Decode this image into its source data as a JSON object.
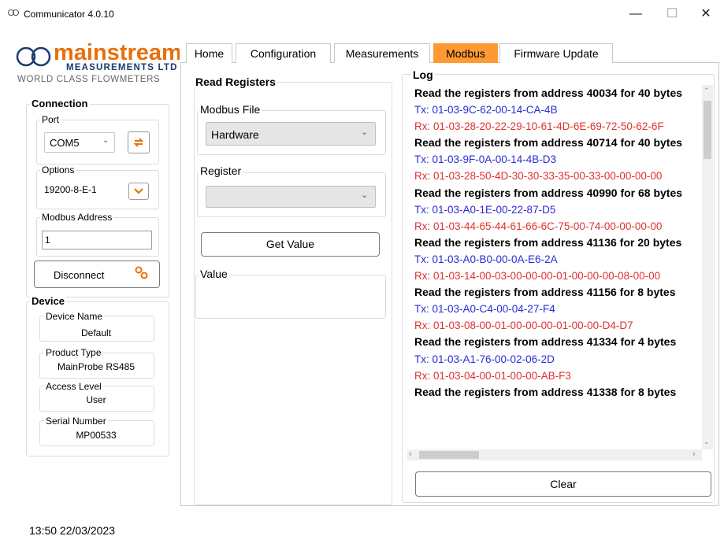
{
  "window": {
    "title": "Communicator 4.0.10",
    "controls": [
      "—",
      "☐",
      "✕"
    ]
  },
  "logo": {
    "brand": "mainstream",
    "sub": "MEASUREMENTS LTD",
    "tagline": "WORLD CLASS FLOWMETERS"
  },
  "connection": {
    "title": "Connection",
    "port_label": "Port",
    "port_value": "COM5",
    "options_label": "Options",
    "options_value": "19200-8-E-1",
    "address_label": "Modbus Address",
    "address_value": "1",
    "disconnect_label": "Disconnect"
  },
  "device": {
    "title": "Device",
    "name_label": "Device Name",
    "name_value": "Default",
    "product_label": "Product Type",
    "product_value": "MainProbe RS485",
    "access_label": "Access Level",
    "access_value": "User",
    "serial_label": "Serial Number",
    "serial_value": "MP00533"
  },
  "tabs": [
    {
      "label": "Home",
      "active": false
    },
    {
      "label": "Configuration",
      "active": false
    },
    {
      "label": "Measurements",
      "active": false
    },
    {
      "label": "Modbus",
      "active": true
    },
    {
      "label": "Firmware Update",
      "active": false
    }
  ],
  "read_registers": {
    "title": "Read Registers",
    "file_label": "Modbus File",
    "file_value": "Hardware",
    "register_label": "Register",
    "register_value": "",
    "get_value_label": "Get Value",
    "value_label": "Value"
  },
  "log": {
    "title": "Log",
    "clear_label": "Clear",
    "entries": [
      {
        "kind": "read",
        "text": "Read the registers from address 40034 for 40 bytes"
      },
      {
        "kind": "tx",
        "text": "Tx: 01-03-9C-62-00-14-CA-4B"
      },
      {
        "kind": "rx",
        "text": "Rx: 01-03-28-20-22-29-10-61-4D-6E-69-72-50-62-6F"
      },
      {
        "kind": "read",
        "text": "Read the registers from address 40714 for 40 bytes"
      },
      {
        "kind": "tx",
        "text": "Tx: 01-03-9F-0A-00-14-4B-D3"
      },
      {
        "kind": "rx",
        "text": "Rx: 01-03-28-50-4D-30-30-33-35-00-33-00-00-00-00"
      },
      {
        "kind": "read",
        "text": "Read the registers from address 40990 for 68 bytes"
      },
      {
        "kind": "tx",
        "text": "Tx: 01-03-A0-1E-00-22-87-D5"
      },
      {
        "kind": "rx",
        "text": "Rx: 01-03-44-65-44-61-66-6C-75-00-74-00-00-00-00"
      },
      {
        "kind": "read",
        "text": "Read the registers from address 41136 for 20 bytes"
      },
      {
        "kind": "tx",
        "text": "Tx: 01-03-A0-B0-00-0A-E6-2A"
      },
      {
        "kind": "rx",
        "text": "Rx: 01-03-14-00-03-00-00-00-01-00-00-00-08-00-00"
      },
      {
        "kind": "read",
        "text": "Read the registers from address 41156 for 8 bytes"
      },
      {
        "kind": "tx",
        "text": "Tx: 01-03-A0-C4-00-04-27-F4"
      },
      {
        "kind": "rx",
        "text": "Rx: 01-03-08-00-01-00-00-00-01-00-00-D4-D7"
      },
      {
        "kind": "read",
        "text": "Read the registers from address 41334 for 4 bytes"
      },
      {
        "kind": "tx",
        "text": "Tx: 01-03-A1-76-00-02-06-2D"
      },
      {
        "kind": "rx",
        "text": "Rx: 01-03-04-00-01-00-00-AB-F3"
      },
      {
        "kind": "read",
        "text": "Read the registers from address 41338 for 8 bytes"
      }
    ]
  },
  "status": {
    "time": "13:50 22/03/2023"
  },
  "colors": {
    "active_tab": "#ff9933",
    "tx": "#2b2bd6",
    "rx": "#e03030",
    "accent_icon": "#e8700a"
  }
}
